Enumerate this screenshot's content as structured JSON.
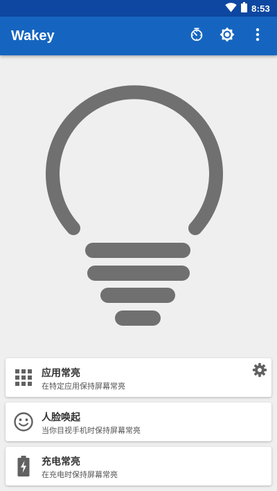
{
  "status_bar": {
    "time": "8:53",
    "icons": [
      "wifi-icon",
      "battery-icon"
    ]
  },
  "app_bar": {
    "title": "Wakey",
    "actions": [
      "timer-icon",
      "brightness-icon",
      "more-vert-icon"
    ]
  },
  "main": {
    "bulb_icon": "lightbulb-icon",
    "bulb_color": "#707070"
  },
  "cards": [
    {
      "icon": "apps-grid-icon",
      "title": "应用常亮",
      "subtitle": "在特定应用保持屏幕常亮",
      "has_settings": true
    },
    {
      "icon": "face-icon",
      "title": "人脸唤起",
      "subtitle": "当你目视手机时保持屏幕常亮",
      "has_settings": false
    },
    {
      "icon": "battery-charging-icon",
      "title": "充电常亮",
      "subtitle": "在充电时保持屏幕常亮",
      "has_settings": false
    }
  ],
  "colors": {
    "status_bar": "#0d47a1",
    "app_bar": "#1565c0",
    "background": "#efefef",
    "icon_gray": "#616161"
  }
}
